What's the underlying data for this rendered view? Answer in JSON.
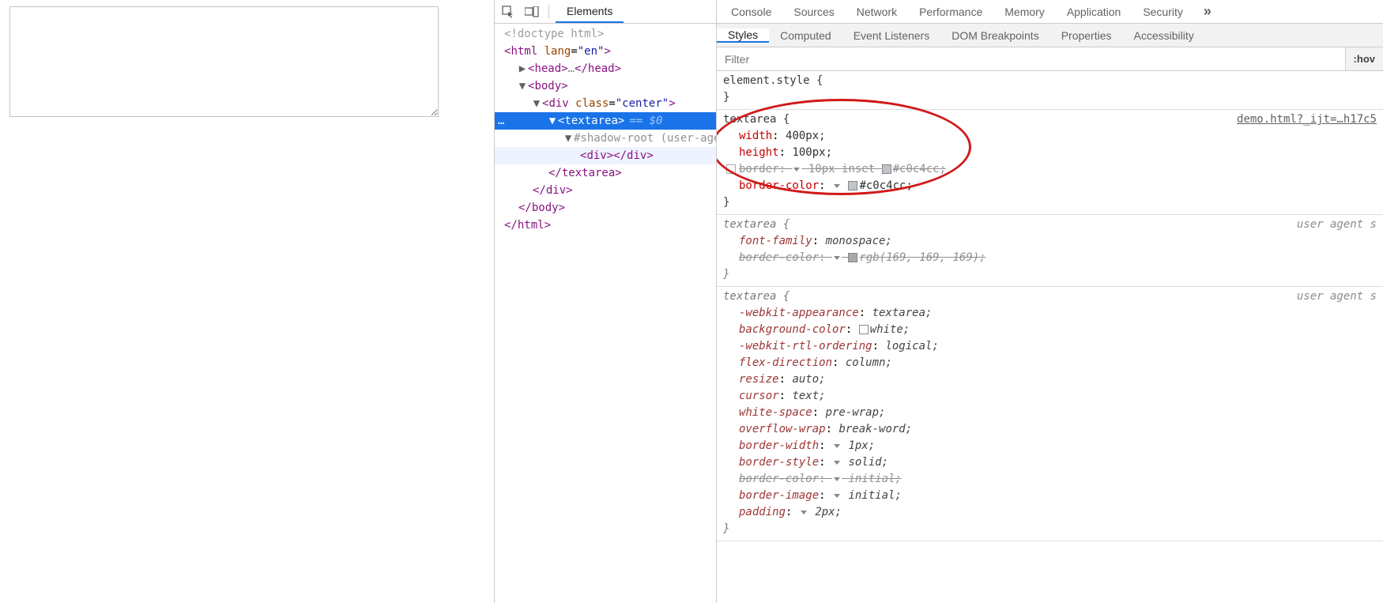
{
  "mainTabs": [
    "Elements",
    "Console",
    "Sources",
    "Network",
    "Performance",
    "Memory",
    "Application",
    "Security"
  ],
  "mainTabActive": 0,
  "subTabs": [
    "Styles",
    "Computed",
    "Event Listeners",
    "DOM Breakpoints",
    "Properties",
    "Accessibility"
  ],
  "subTabActive": 0,
  "filterPlaceholder": "Filter",
  "hovLabel": ":hov",
  "moreGlyph": "»",
  "dom": {
    "doctype": "<!doctype html>",
    "htmlOpen": "<html lang=\"en\">",
    "headOpen": "<head>",
    "headDots": "…",
    "headClose": "</head>",
    "bodyOpen": "<body>",
    "divOpen": "<div class=\"center\">",
    "textareaOpen": "<textarea>",
    "eq0": "== $0",
    "shadow": "#shadow-root (user-agent)",
    "innerDiv": "<div></div>",
    "textareaClose": "</textarea>",
    "divClose": "</div>",
    "bodyClose": "</body>",
    "htmlClose": "</html>",
    "selectedDots": "…"
  },
  "rules": {
    "elementStyle": {
      "selector": "element.style",
      "open": "{",
      "close": "}"
    },
    "authored": {
      "selector": "textarea",
      "open": "{",
      "close": "}",
      "origin": "demo.html?_ijt=…h17c5",
      "props": [
        {
          "name": "width",
          "val": "400px;",
          "struck": false,
          "cb": false,
          "tri": false,
          "swatch": null
        },
        {
          "name": "height",
          "val": "100px;",
          "struck": false,
          "cb": false,
          "tri": false,
          "swatch": null
        },
        {
          "name": "border",
          "val": "10px inset ",
          "struck": true,
          "cb": true,
          "tri": true,
          "swatch": "#c0c4cc",
          "swatchText": "#c0c4cc;"
        },
        {
          "name": "border-color",
          "val": "",
          "struck": false,
          "cb": false,
          "tri": true,
          "swatch": "#c0c4cc",
          "swatchText": "#c0c4cc;"
        }
      ]
    },
    "ua1": {
      "selector": "textarea",
      "open": "{",
      "close": "}",
      "origin": "user agent s",
      "props": [
        {
          "name": "font-family",
          "val": "monospace;",
          "struck": false,
          "tri": false,
          "swatch": null
        },
        {
          "name": "border-color",
          "val": "",
          "struck": true,
          "tri": true,
          "swatch": "rgb(169,169,169)",
          "swatchText": "rgb(169, 169, 169);"
        }
      ]
    },
    "ua2": {
      "selector": "textarea",
      "open": "{",
      "close": "}",
      "origin": "user agent s",
      "props": [
        {
          "name": "-webkit-appearance",
          "val": "textarea;",
          "struck": false,
          "tri": false,
          "swatch": null
        },
        {
          "name": "background-color",
          "val": "",
          "struck": false,
          "tri": false,
          "swatch": "#ffffff",
          "swatchText": "white;"
        },
        {
          "name": "-webkit-rtl-ordering",
          "val": "logical;",
          "struck": false,
          "tri": false,
          "swatch": null
        },
        {
          "name": "flex-direction",
          "val": "column;",
          "struck": false,
          "tri": false,
          "swatch": null
        },
        {
          "name": "resize",
          "val": "auto;",
          "struck": false,
          "tri": false,
          "swatch": null
        },
        {
          "name": "cursor",
          "val": "text;",
          "struck": false,
          "tri": false,
          "swatch": null
        },
        {
          "name": "white-space",
          "val": "pre-wrap;",
          "struck": false,
          "tri": false,
          "swatch": null
        },
        {
          "name": "overflow-wrap",
          "val": "break-word;",
          "struck": false,
          "tri": false,
          "swatch": null
        },
        {
          "name": "border-width",
          "val": "1px;",
          "struck": false,
          "tri": true,
          "swatch": null
        },
        {
          "name": "border-style",
          "val": "solid;",
          "struck": false,
          "tri": true,
          "swatch": null
        },
        {
          "name": "border-color",
          "val": "initial;",
          "struck": true,
          "tri": true,
          "swatch": null
        },
        {
          "name": "border-image",
          "val": "initial;",
          "struck": false,
          "tri": true,
          "swatch": null
        },
        {
          "name": "padding",
          "val": "2px;",
          "struck": false,
          "tri": true,
          "swatch": null
        }
      ]
    }
  }
}
